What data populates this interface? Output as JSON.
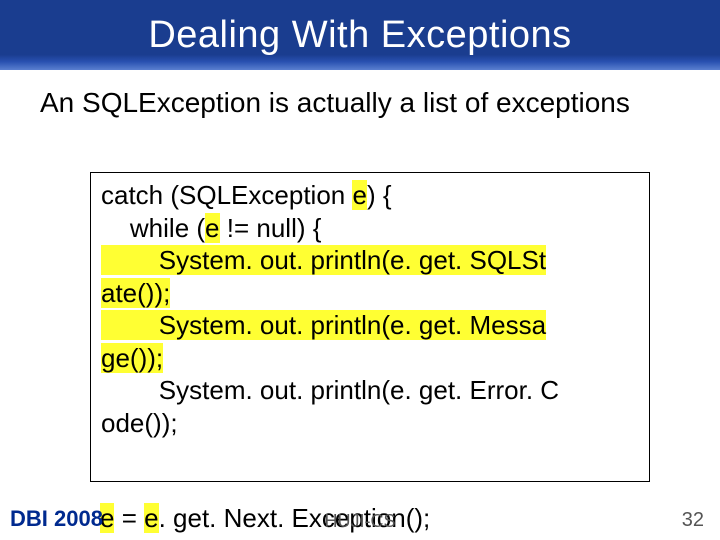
{
  "title": "Dealing With Exceptions",
  "intro": "An SQLException is actually a list of exceptions",
  "code": {
    "l1a": "catch (SQLException ",
    "l1b": "e",
    "l1c": ") {",
    "l2a": "    while (",
    "l2b": "e",
    "l2c": " != null) {",
    "l3": "        System. out. println(e. get. SQLSt",
    "l4a": "ate());",
    "l5": "        System. out. println(e. get. Messa",
    "l6a": "ge());",
    "l7": "        System. out. println(e. get. Error. C",
    "l8": "ode());",
    "l9a": "        ",
    "l9b": "e",
    "l9c": " = ",
    "l9d": "e",
    "l9e": ". get. Next. Exception();"
  },
  "footer": {
    "left": "DBI 2008",
    "center": "HUJI-CS",
    "right": "32"
  }
}
